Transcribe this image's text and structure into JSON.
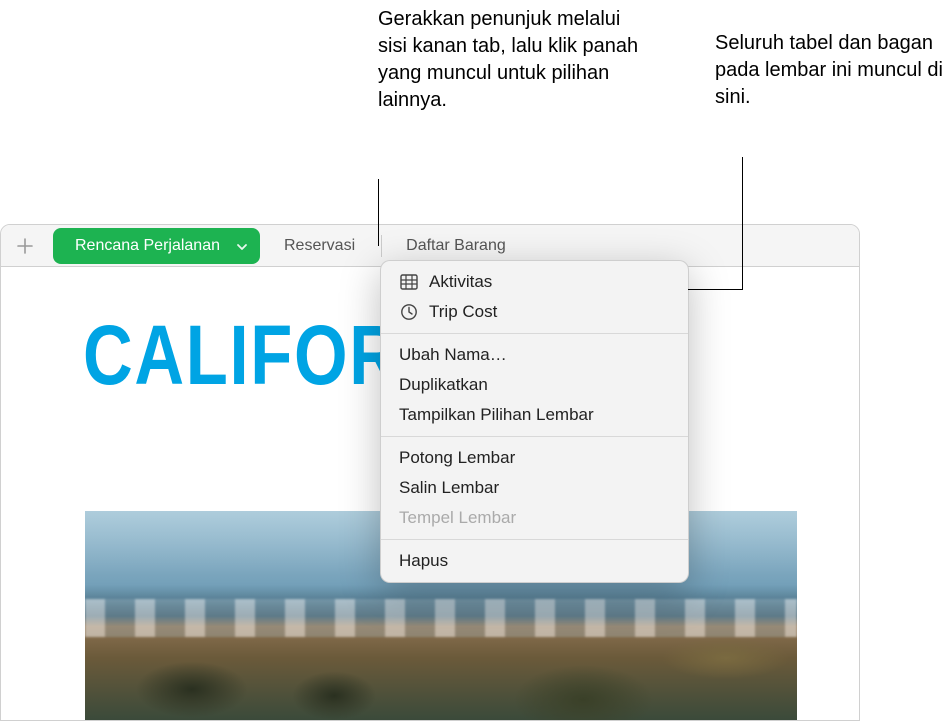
{
  "callouts": {
    "left": "Gerakkan penunjuk melalui sisi kanan tab, lalu klik panah yang muncul untuk pilihan lainnya.",
    "right": "Seluruh tabel dan bagan pada lembar ini muncul di sini."
  },
  "tabs": {
    "active": "Rencana Perjalanan",
    "second": "Reservasi",
    "third": "Daftar Barang"
  },
  "canvas": {
    "title": "CALIFORNIA"
  },
  "menu": {
    "object_table": "Aktivitas",
    "object_chart": "Trip Cost",
    "rename": "Ubah Nama…",
    "duplicate": "Duplikatkan",
    "show_options": "Tampilkan Pilihan Lembar",
    "cut": "Potong Lembar",
    "copy": "Salin Lembar",
    "paste": "Tempel Lembar",
    "delete": "Hapus"
  }
}
